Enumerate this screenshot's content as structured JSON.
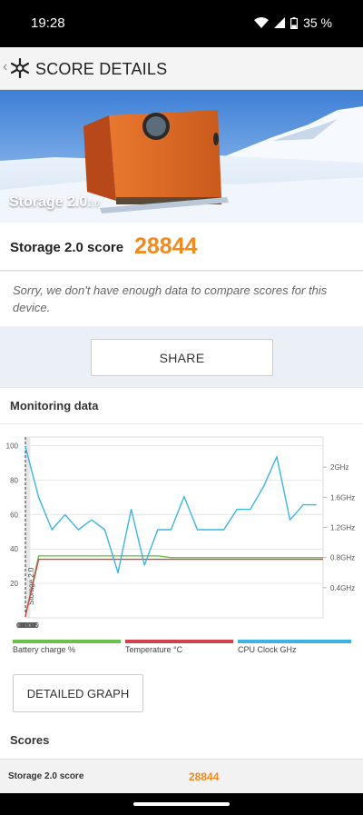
{
  "status": {
    "time": "19:28",
    "battery": "35 %"
  },
  "header": {
    "title": "SCORE DETAILS"
  },
  "hero": {
    "title": "Storage 2.0",
    "version": "2.0"
  },
  "score": {
    "label": "Storage 2.0 score",
    "value": "28844"
  },
  "notice": "Sorry, we don't have enough data to compare scores for this device.",
  "share": {
    "label": "SHARE"
  },
  "monitoring": {
    "title": "Monitoring data",
    "detailed_button": "DETAILED GRAPH",
    "scores_heading": "Scores"
  },
  "scores_table": [
    {
      "label": "Storage 2.0 score",
      "value": "28844"
    }
  ],
  "chart_data": {
    "type": "line",
    "x_ticks": [
      "00:00",
      "00:04",
      "00:08",
      "00:12",
      "00:16",
      "00:20"
    ],
    "y_left_ticks": [
      100,
      80,
      60,
      40,
      20
    ],
    "y_right_ticks": [
      "2GHz",
      "1.6GHz",
      "1.2GHz",
      "0.8GHz",
      "0.4GHz"
    ],
    "x_range_minutes": [
      0,
      22.5
    ],
    "y_left_range": [
      0,
      105
    ],
    "y_right_range_ghz": [
      0,
      2.4
    ],
    "marker": {
      "label": "Storage 2.0",
      "x": 0
    },
    "legend": [
      "Battery charge %",
      "Temperature °C",
      "CPU Clock GHz"
    ],
    "colors": {
      "battery": "#6cc04a",
      "temperature": "#d0434b",
      "cpu": "#3cb5e5"
    },
    "series": [
      {
        "name": "Battery charge %",
        "x": [
          0,
          1,
          2,
          4,
          6,
          8,
          10,
          11,
          12,
          14,
          16,
          18,
          20,
          22.5
        ],
        "y": [
          1,
          36,
          36,
          36,
          36,
          36,
          36,
          35,
          35,
          35,
          35,
          35,
          35,
          35
        ]
      },
      {
        "name": "Temperature °C",
        "x": [
          0,
          1,
          2,
          4,
          6,
          8,
          10,
          12,
          14,
          16,
          18,
          20,
          22.5
        ],
        "y": [
          1,
          34,
          34,
          34,
          34,
          34,
          34,
          34,
          34,
          34,
          34,
          34,
          34
        ]
      },
      {
        "name": "CPU Clock GHz",
        "x": [
          0,
          1,
          2,
          3,
          4,
          5,
          6,
          7,
          8,
          9,
          10,
          11,
          12,
          13,
          14,
          15,
          16,
          17,
          18,
          19,
          20,
          21,
          22
        ],
        "y": [
          2.27,
          1.6,
          1.17,
          1.37,
          1.17,
          1.3,
          1.17,
          0.6,
          1.44,
          0.7,
          1.17,
          1.17,
          1.61,
          1.17,
          1.17,
          1.17,
          1.44,
          1.44,
          1.74,
          2.14,
          1.3,
          1.5,
          1.5
        ]
      }
    ]
  }
}
